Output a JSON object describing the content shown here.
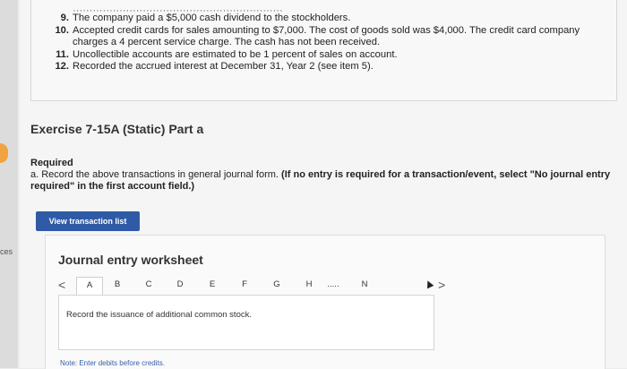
{
  "left_rail": {
    "label": "ces"
  },
  "transactions": [
    {
      "number": "",
      "text": "·······························································"
    },
    {
      "number": "9.",
      "text": "The company paid a $5,000 cash dividend to the stockholders."
    },
    {
      "number": "10.",
      "text": "Accepted credit cards for sales amounting to $7,000. The cost of goods sold was $4,000. The credit card company charges a 4 percent service charge. The cash has not been received."
    },
    {
      "number": "11.",
      "text": "Uncollectible accounts are estimated to be 1 percent of sales on account."
    },
    {
      "number": "12.",
      "text": "Recorded the accrued interest at December 31, Year 2 (see item 5)."
    }
  ],
  "exercise_title": "Exercise 7-15A (Static) Part a",
  "required": {
    "heading": "Required",
    "text": "a. Record the above transactions in general journal form. ",
    "bold_note": "(If no entry is required for a transaction/event, select \"No journal entry required\" in the first account field.)"
  },
  "view_button_label": "View transaction list",
  "worksheet": {
    "title": "Journal entry worksheet",
    "prev_arrow": "<",
    "next_arrow": ">",
    "tabs": [
      "A",
      "B",
      "C",
      "D",
      "E",
      "F",
      "G",
      "H",
      ".....",
      "N"
    ],
    "active_tab": "A",
    "entry_description": "Record the issuance of additional common stock.",
    "note": "Note: Enter debits before credits."
  }
}
